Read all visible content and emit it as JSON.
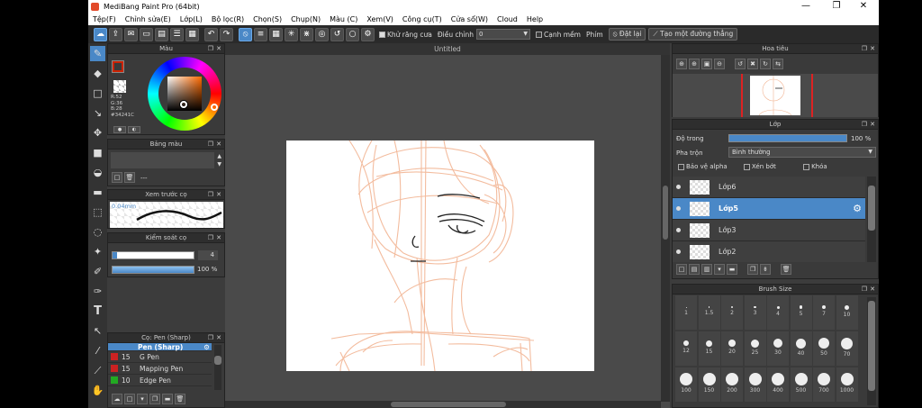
{
  "window": {
    "title": "MediBang Paint Pro (64bit)",
    "minimize": "—",
    "maximize": "❐",
    "close": "✕"
  },
  "menu": [
    "Tệp(F)",
    "Chỉnh sửa(E)",
    "Lớp(L)",
    "Bộ lọc(R)",
    "Chọn(S)",
    "Chụp(N)",
    "Màu (C)",
    "Xem(V)",
    "Công cụ(T)",
    "Cửa sổ(W)",
    "Cloud",
    "Help"
  ],
  "toolbar": {
    "antialias_label": "Khử răng cưa",
    "adjust_label": "Điều chỉnh",
    "adjust_value": "0",
    "edge_label": "Cạnh mềm",
    "key_label": "Phím",
    "reset_label": "Đặt lại",
    "straight_line_label": "Tạo một đường thẳng"
  },
  "color_panel": {
    "title": "Màu",
    "r": "R:52",
    "g": "G:36",
    "b": "B:28",
    "hex": "#34241C",
    "primary": "#cc2200"
  },
  "palette_panel": {
    "title": "Bảng màu",
    "dash": "---"
  },
  "brush_preview": {
    "title": "Xem trước cọ",
    "size": "0.04mm"
  },
  "brush_control": {
    "title": "Kiểm soát cọ",
    "size": "4",
    "opacity": "100 %"
  },
  "brush_list": {
    "title": "Cọ: Pen (Sharp)",
    "items": [
      {
        "size": "",
        "name": "Pen (Sharp)",
        "color": "#cc2222"
      },
      {
        "size": "15",
        "name": "G Pen",
        "color": "#cc2222"
      },
      {
        "size": "15",
        "name": "Mapping Pen",
        "color": "#cc2222"
      },
      {
        "size": "10",
        "name": "Edge Pen",
        "color": "#22aa22"
      }
    ]
  },
  "canvas": {
    "tab": "Untitled"
  },
  "navigator": {
    "title": "Hoa tiêu"
  },
  "layer_panel": {
    "title": "Lớp",
    "opacity_label": "Độ trong",
    "opacity_value": "100 %",
    "opacity": 1.0,
    "blend_label": "Pha trộn",
    "blend_value": "Bình thường",
    "protect_alpha": "Bảo vệ alpha",
    "clipping": "Xén bớt",
    "lock": "Khóa",
    "layers": [
      "Lớp6",
      "Lớp5",
      "Lớp3",
      "Lớp2"
    ],
    "selected": "Lớp5"
  },
  "brush_size": {
    "title": "Brush Size",
    "sizes": [
      "1",
      "1.5",
      "2",
      "3",
      "4",
      "5",
      "7",
      "10",
      "12",
      "15",
      "20",
      "25",
      "30",
      "40",
      "50",
      "70",
      "100",
      "150",
      "200",
      "300",
      "400",
      "500",
      "700",
      "1000"
    ]
  },
  "sketch_color": "#f2b594"
}
